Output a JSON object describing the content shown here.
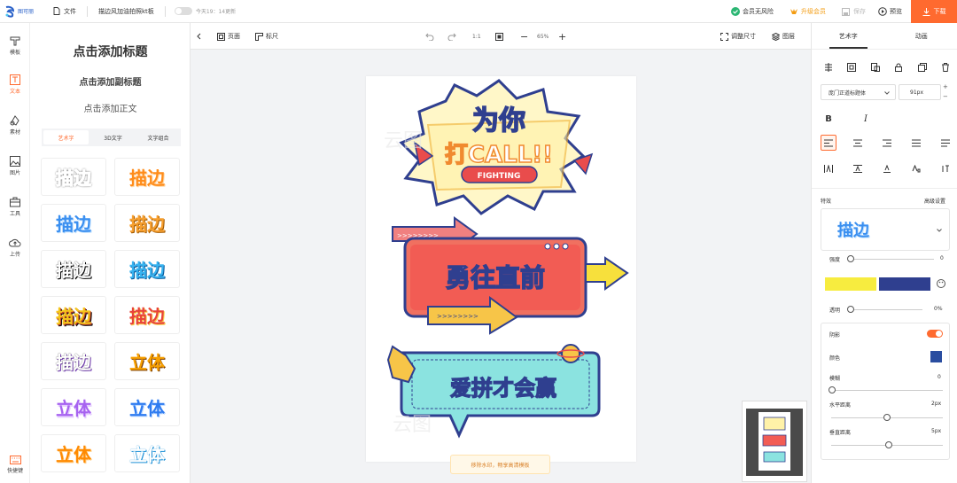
{
  "app": {
    "logo_text": "图可丽",
    "file_label": "文件",
    "doc_title": "描边风加油拍照kt板",
    "autosave": "今天19：14更新"
  },
  "topbar": {
    "risk": "会员无风险",
    "upgrade": "升级会员",
    "save": "保存",
    "preview": "预览",
    "download": "下载"
  },
  "nav": {
    "items": [
      {
        "label": "模板",
        "icon": "template-icon"
      },
      {
        "label": "文本",
        "icon": "text-icon"
      },
      {
        "label": "素材",
        "icon": "material-icon"
      },
      {
        "label": "图片",
        "icon": "image-icon"
      },
      {
        "label": "工具",
        "icon": "toolbox-icon"
      },
      {
        "label": "上传",
        "icon": "upload-icon"
      }
    ],
    "shortcut": "快捷键"
  },
  "text_panel": {
    "add_title": "点击添加标题",
    "add_subtitle": "点击添加副标题",
    "add_body": "点击添加正文",
    "tabs": [
      "艺术字",
      "3D文字",
      "文字组合"
    ],
    "presets": [
      "描边",
      "描边",
      "描边",
      "描边",
      "描边",
      "描边",
      "描边",
      "描边",
      "描边",
      "描边",
      "描边",
      "立体",
      "立体",
      "立体",
      "立体",
      "立体"
    ]
  },
  "toolbar": {
    "page": "页面",
    "ruler": "标尺",
    "ratio": "1:1",
    "zoom": "65%",
    "resize": "调整尺寸",
    "layers": "图层"
  },
  "canvas": {
    "watermark_button": "移除水印，畅享高清模板",
    "sticker1_line1": "为你",
    "sticker1_line2": "打CALL!!",
    "sticker1_tag": "FIGHTING",
    "sticker2_text": "勇往直前",
    "sticker3_text": "爱拼才会赢",
    "watermark_text": "云图"
  },
  "right_panel": {
    "tabs": [
      "艺术字",
      "动画"
    ],
    "font": "庞门正道标题体",
    "font_size": "91px",
    "effects_label": "特效",
    "advanced": "高级设置",
    "effect_preview": "描边",
    "strength_label": "强度",
    "strength_value": "0",
    "opacity_label": "透明",
    "opacity_value": "0%",
    "shadow_label": "阴影",
    "shadow_color_label": "颜色",
    "blur_label": "模糊",
    "blur_value": "0",
    "hdist_label": "水平距离",
    "hdist_value": "2px",
    "vdist_label": "垂直距离",
    "vdist_value": "5px"
  },
  "colors": {
    "accent": "#ff6a2f",
    "stroke1": "#f7ec3f",
    "stroke2": "#2f3f8f",
    "shadow": "#2a4da0"
  }
}
